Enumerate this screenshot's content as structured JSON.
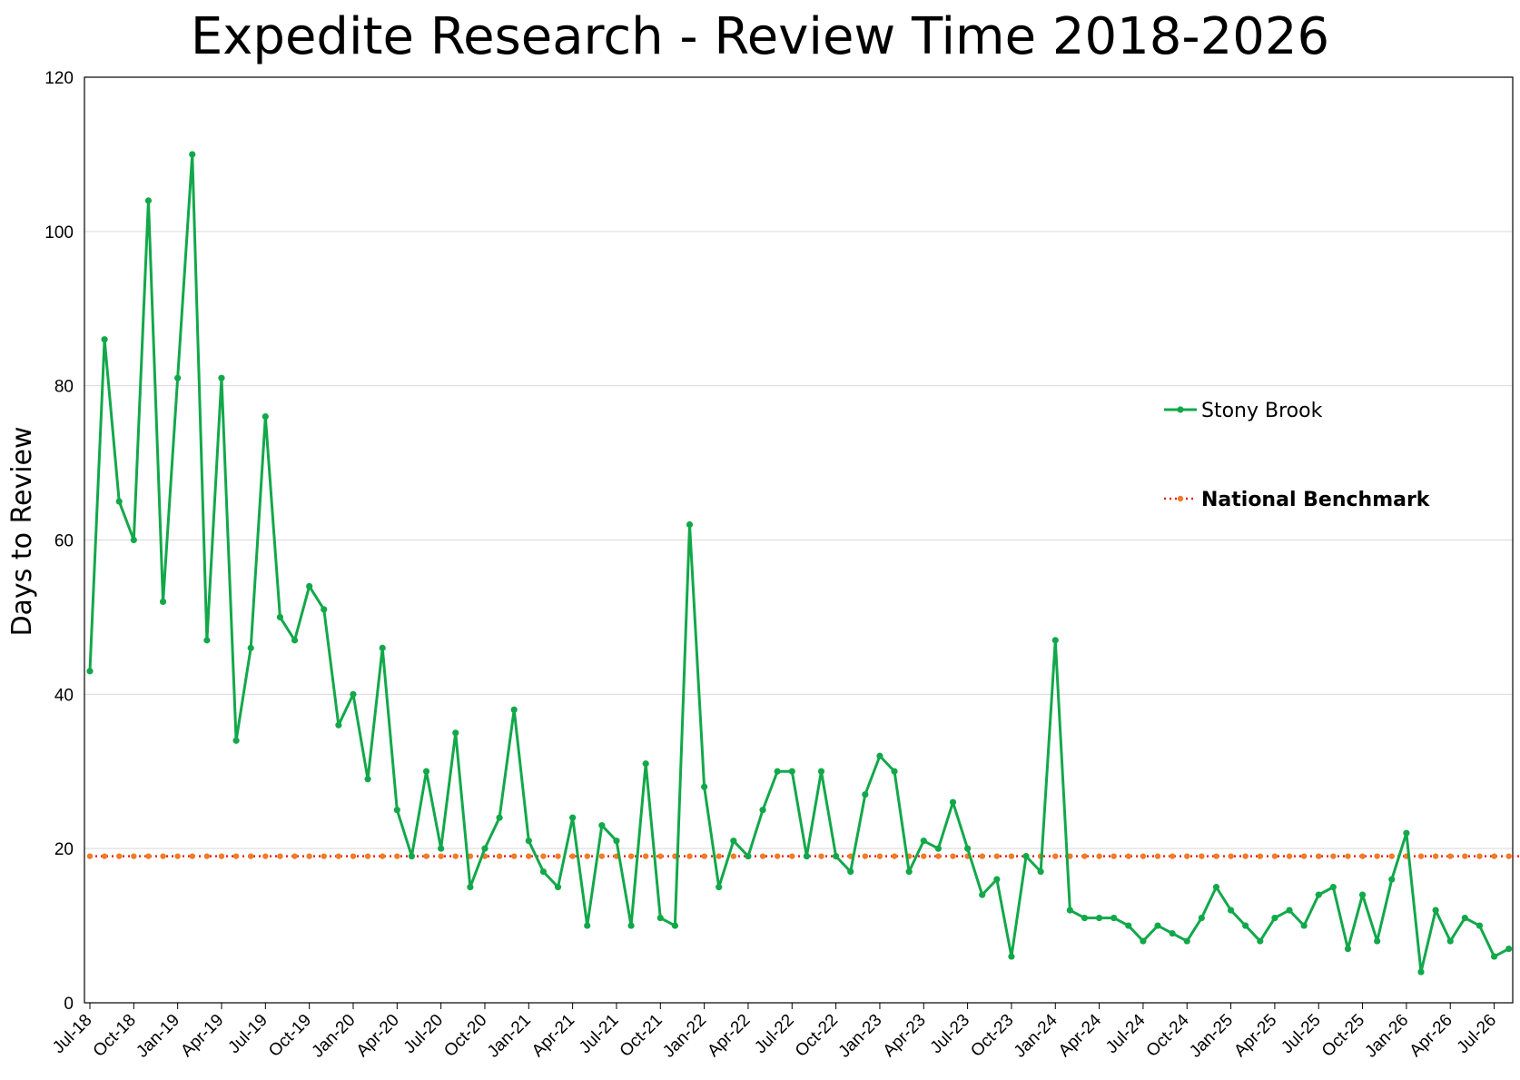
{
  "chart_data": {
    "type": "line",
    "title": "Expedite Research - Review Time 2018-2026",
    "xlabel": "",
    "ylabel": "Days to Review",
    "ylim": [
      0,
      120
    ],
    "yticks": [
      "0",
      "20",
      "40",
      "60",
      "80",
      "100",
      "120"
    ],
    "xlim_months": [
      "Jul-18",
      "Oct-26"
    ],
    "x_tick_labels": [
      "Jul-18",
      "Oct-18",
      "Jan-19",
      "Apr-19",
      "Jul-19",
      "Oct-19",
      "Jan-20",
      "Apr-20",
      "Jul-20",
      "Oct-20",
      "Jan-21",
      "Apr-21",
      "Jul-21",
      "Oct-21",
      "Jan-22",
      "Apr-22",
      "Jul-22",
      "Oct-22",
      "Jan-23",
      "Apr-23",
      "Jul-23",
      "Oct-23",
      "Jan-24",
      "Apr-24",
      "Jul-24",
      "Oct-24",
      "Jan-25",
      "Apr-25",
      "Jul-25",
      "Oct-25",
      "Jan-26",
      "Apr-26",
      "Jul-26"
    ],
    "grid": "horizontal",
    "legend_position": "right",
    "colors": {
      "stony_brook": "#12a84a",
      "benchmark": "#f07c2a",
      "benchmark_line": "#e8221c"
    },
    "series": [
      {
        "name": "Stony Brook",
        "values": [
          43,
          86,
          65,
          60,
          104,
          52,
          81,
          110,
          47,
          81,
          34,
          46,
          76,
          50,
          47,
          54,
          51,
          36,
          40,
          29,
          46,
          25,
          19,
          30,
          20,
          35,
          15,
          20,
          24,
          38,
          21,
          17,
          15,
          24,
          10,
          23,
          21,
          10,
          31,
          11,
          10,
          62,
          28,
          15,
          21,
          19,
          25,
          30,
          30,
          19,
          30,
          19,
          17,
          27,
          32,
          30,
          17,
          21,
          20,
          26,
          20,
          14,
          16,
          6,
          19,
          17,
          47,
          12,
          11,
          11,
          11,
          10,
          8,
          10,
          9,
          8,
          11,
          15,
          12,
          10,
          8,
          11,
          12,
          10,
          14,
          15,
          7,
          14,
          8,
          16,
          22,
          4,
          12,
          8,
          11,
          10,
          6,
          7
        ]
      },
      {
        "name": "National Benchmark",
        "values": [
          19,
          19,
          19,
          19,
          19,
          19,
          19,
          19,
          19,
          19,
          19,
          19,
          19,
          19,
          19,
          19,
          19,
          19,
          19,
          19,
          19,
          19,
          19,
          19,
          19,
          19,
          19,
          19,
          19,
          19,
          19,
          19,
          19,
          19,
          19,
          19,
          19,
          19,
          19,
          19,
          19,
          19,
          19,
          19,
          19,
          19,
          19,
          19,
          19,
          19,
          19,
          19,
          19,
          19,
          19,
          19,
          19,
          19,
          19,
          19,
          19,
          19,
          19,
          19,
          19,
          19,
          19,
          19,
          19,
          19,
          19,
          19,
          19,
          19,
          19,
          19,
          19,
          19,
          19,
          19,
          19,
          19,
          19,
          19,
          19,
          19,
          19,
          19,
          19,
          19,
          19,
          19,
          19,
          19,
          19,
          19,
          19,
          19,
          19
        ]
      }
    ]
  }
}
